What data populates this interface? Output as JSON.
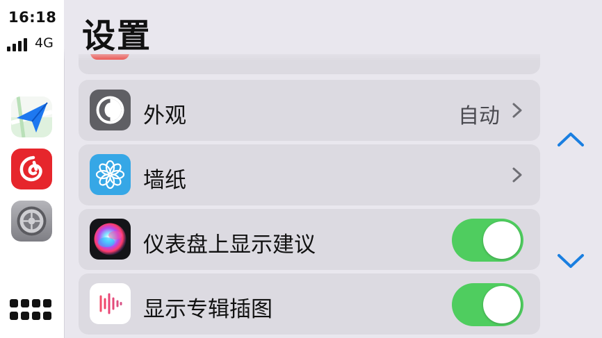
{
  "status": {
    "time": "16:18",
    "network": "4G"
  },
  "sidebar": {
    "apps": [
      {
        "name": "navigation-app"
      },
      {
        "name": "netease-music-app"
      },
      {
        "name": "settings-app"
      }
    ]
  },
  "page": {
    "title": "设置"
  },
  "settings": {
    "rows": [
      {
        "label": "外观",
        "value": "自动",
        "control": "chevron"
      },
      {
        "label": "墙纸",
        "value": "",
        "control": "chevron"
      },
      {
        "label": "仪表盘上显示建议",
        "control": "toggle",
        "on": true
      },
      {
        "label": "显示专辑插图",
        "control": "toggle",
        "on": true
      }
    ]
  },
  "colors": {
    "toggle_on": "#4fcd5f",
    "accent": "#1a7fe0",
    "netease_red": "#e6262c",
    "maps_blue": "#1e78f0"
  },
  "icons": {
    "appearance": "appearance-icon",
    "wallpaper": "flower-icon",
    "siri": "siri-icon",
    "album": "soundwave-icon"
  }
}
